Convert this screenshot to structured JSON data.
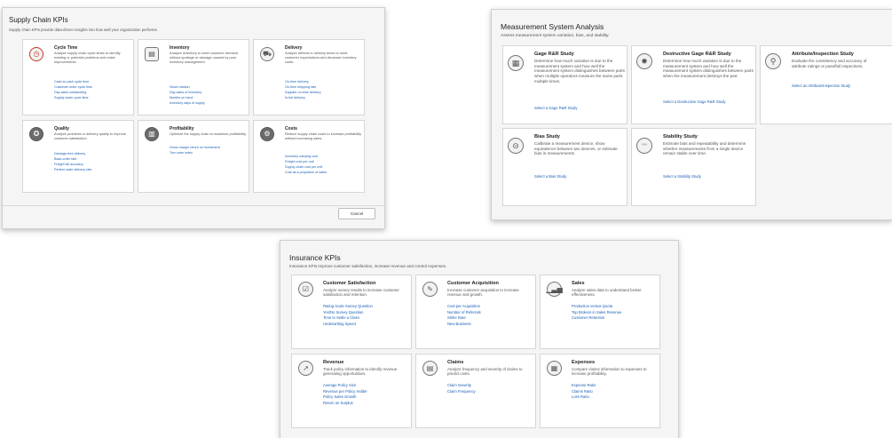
{
  "supply_chain": {
    "title": "Supply Chain KPIs",
    "subtitle": "Supply chain KPIs provide data-driven insights into how well your organization performs.",
    "cancel_label": "Cancel",
    "cards": [
      {
        "title": "Cycle Time",
        "icon": "stopwatch-icon",
        "desc": "Analyze supply chain cycle times to identify existing or potential problems and make improvements.",
        "links": [
          "Cash-to-cash cycle time",
          "Customer order cycle time",
          "Day sales outstanding",
          "Supply chain cycle time"
        ]
      },
      {
        "title": "Inventory",
        "icon": "inventory-icon",
        "desc": "Analyze inventory to meet customer demand without spoilage or damage caused by poor inventory management.",
        "links": [
          "Stock rotation",
          "Day sales of inventory",
          "Months on hand",
          "Inventory days of supply"
        ]
      },
      {
        "title": "Delivery",
        "icon": "delivery-truck-icon",
        "desc": "Analyze defects in delivery times to meet customer expectations and decrease inventory costs.",
        "links": [
          "On-time delivery",
          "On-time shipping rate",
          "Supplier on-time delivery",
          "In-full delivery"
        ]
      },
      {
        "title": "Quality",
        "icon": "quality-badge-icon",
        "desc": "Analyze problems in delivery quality to improve customer satisfaction.",
        "links": [
          "Damage-free delivery",
          "Back-order rate",
          "Freight bill accuracy",
          "Perfect order delivery rate"
        ]
      },
      {
        "title": "Profitability",
        "icon": "profit-chart-icon",
        "desc": "Optimize the supply chain to maximize profitability.",
        "links": [
          "Gross margin return on investment",
          "Turn-earn index"
        ]
      },
      {
        "title": "Costs",
        "icon": "costs-gears-icon",
        "desc": "Reduce supply chain costs to increase profitability without increasing sales.",
        "links": [
          "Inventory carrying cost",
          "Freight cost per unit",
          "Supply chain cost per unit",
          "Cost as a proportion of sales"
        ]
      }
    ]
  },
  "msa": {
    "title": "Measurement System Analysis",
    "subtitle": "Assess measurement system variation, bias, and stability.",
    "cards": [
      {
        "title": "Gage R&R Study",
        "icon": "gage-icon",
        "desc": "Determine how much variation is due to the measurement system and how well the measurement system distinguishes between parts when multiple operators measure the same parts multiple times.",
        "links": [
          "Select a Gage R&R Study"
        ]
      },
      {
        "title": "Destructive Gage R&R Study",
        "icon": "destructive-gage-icon",
        "desc": "Determine how much variation is due to the measurement system and how well the measurement system distinguishes between parts when the measurement destroys the part.",
        "links": [
          "Select a Destructive Gage R&R Study"
        ]
      },
      {
        "title": "Attribute/Inspection Study",
        "icon": "magnifier-icon",
        "desc": "Evaluate the consistency and accuracy of attribute ratings or pass/fail inspections.",
        "links": [
          "Select an Attribute/Inspection Study"
        ]
      },
      {
        "title": "Bias Study",
        "icon": "bias-gauge-icon",
        "desc": "Calibrate a measurement device, show equivalence between two devices, or estimate bias in measurements.",
        "links": [
          "Select a Bias Study"
        ]
      },
      {
        "title": "Stability Study",
        "icon": "stability-icon",
        "desc": "Estimate bias and repeatability and determine whether measurements from a single device remain stable over time.",
        "links": [
          "Select a Stability Study"
        ]
      }
    ]
  },
  "insurance": {
    "title": "Insurance KPIs",
    "subtitle": "Insurance KPIs improve customer satisfaction, increase revenue and control expenses.",
    "cards": [
      {
        "title": "Customer Satisfaction",
        "icon": "survey-icon",
        "desc": "Analyze survey results to increase customer satisfaction and retention.",
        "links": [
          "Rating Scale Survey Question",
          "Yes/No Survey Question",
          "Time to Settle a Claim",
          "Underwriting Speed"
        ]
      },
      {
        "title": "Customer Acquisition",
        "icon": "acquisition-icon",
        "desc": "Increase customer acquisition to increase revenue and growth.",
        "links": [
          "Cost per Acquisition",
          "Number of Referrals",
          "Strike Rate",
          "New Business"
        ]
      },
      {
        "title": "Sales",
        "icon": "sales-chart-icon",
        "desc": "Analyze sales data to understand broker effectiveness.",
        "links": [
          "Production versus Quota",
          "Top Brokers in Sales Revenue",
          "Customer Retention"
        ]
      },
      {
        "title": "Revenue",
        "icon": "revenue-icon",
        "desc": "Track policy information to identify revenue generating opportunities.",
        "links": [
          "Average Policy Size",
          "Revenue per Policy Holder",
          "Policy Sales Growth",
          "Return on Surplus"
        ]
      },
      {
        "title": "Claims",
        "icon": "claims-doc-icon",
        "desc": "Analyze frequency and severity of claims to predict costs.",
        "links": [
          "Claim Severity",
          "Claim Frequency"
        ]
      },
      {
        "title": "Expenses",
        "icon": "expenses-calculator-icon",
        "desc": "Compare claims information to expenses to increase profitability.",
        "links": [
          "Expense Ratio",
          "Claims Ratio",
          "Loss Ratio"
        ]
      }
    ]
  }
}
